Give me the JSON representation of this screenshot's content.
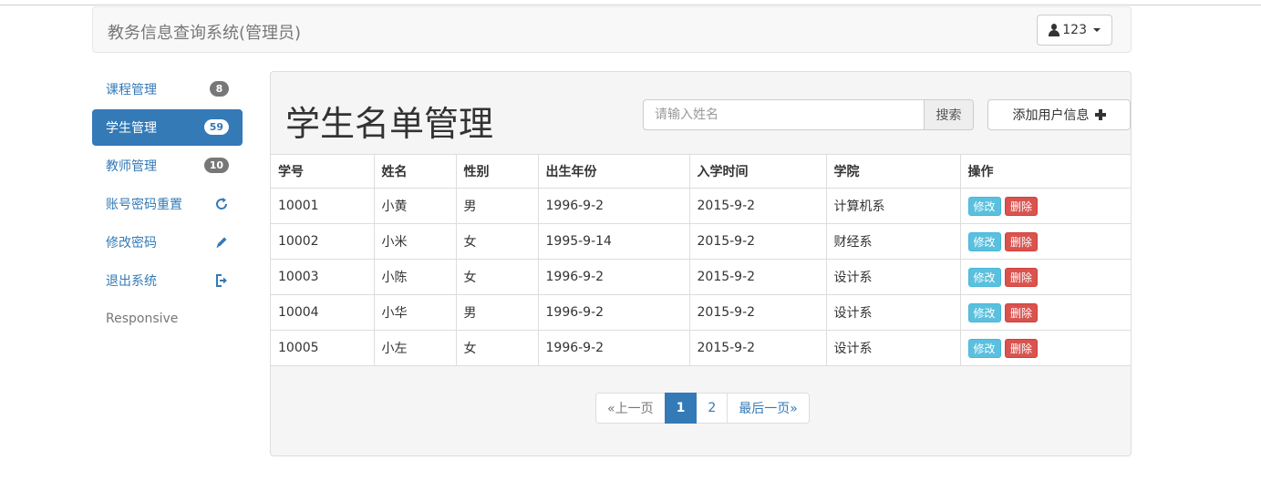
{
  "navbar": {
    "brand": "教务信息查询系统(管理员)",
    "user_label": "123"
  },
  "sidebar": {
    "items": [
      {
        "label": "课程管理",
        "badge": "8"
      },
      {
        "label": "学生管理",
        "badge": "59"
      },
      {
        "label": "教师管理",
        "badge": "10"
      },
      {
        "label": "账号密码重置",
        "icon": "refresh-icon"
      },
      {
        "label": "修改密码",
        "icon": "pencil-icon"
      },
      {
        "label": "退出系统",
        "icon": "logout-icon"
      }
    ],
    "footer_text": "Responsive"
  },
  "main": {
    "title": "学生名单管理",
    "search": {
      "placeholder": "请输入姓名",
      "value": "",
      "button_label": "搜索"
    },
    "add_button_label": "添加用户信息",
    "table": {
      "headers": [
        "学号",
        "姓名",
        "性别",
        "出生年份",
        "入学时间",
        "学院",
        "操作"
      ],
      "rows": [
        [
          "10001",
          "小黄",
          "男",
          "1996-9-2",
          "2015-9-2",
          "计算机系"
        ],
        [
          "10002",
          "小米",
          "女",
          "1995-9-14",
          "2015-9-2",
          "财经系"
        ],
        [
          "10003",
          "小陈",
          "女",
          "1996-9-2",
          "2015-9-2",
          "设计系"
        ],
        [
          "10004",
          "小华",
          "男",
          "1996-9-2",
          "2015-9-2",
          "设计系"
        ],
        [
          "10005",
          "小左",
          "女",
          "1996-9-2",
          "2015-9-2",
          "设计系"
        ]
      ],
      "edit_label": "修改",
      "delete_label": "删除"
    },
    "pagination": {
      "prev": "«上一页",
      "pages": [
        "1",
        "2"
      ],
      "current": "1",
      "last": "最后一页»"
    }
  },
  "colors": {
    "primary": "#337ab7",
    "info": "#5bc0de",
    "danger": "#d9534f",
    "badge": "#777777"
  }
}
